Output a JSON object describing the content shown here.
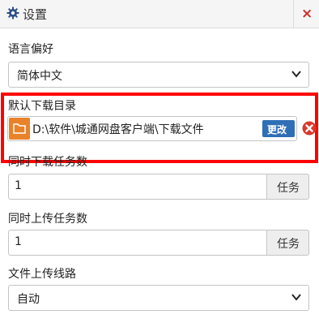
{
  "window": {
    "title": "设置",
    "close_label": "×"
  },
  "language": {
    "label": "语言偏好",
    "selected": "简体中文"
  },
  "download_dir": {
    "label": "默认下载目录",
    "path": "D:\\软件\\城通网盘客户端\\下载文件",
    "change_label": "更改"
  },
  "concurrent_downloads": {
    "label": "同时下载任务数",
    "value": "1",
    "unit": "任务"
  },
  "concurrent_uploads": {
    "label": "同时上传任务数",
    "value": "1",
    "unit": "任务"
  },
  "upload_route": {
    "label": "文件上传线路",
    "selected": "自动"
  },
  "colors": {
    "highlight": "#ff0000",
    "accent_button": "#2f6fb5",
    "folder_button": "#e8832a",
    "delete": "#d9382b"
  }
}
